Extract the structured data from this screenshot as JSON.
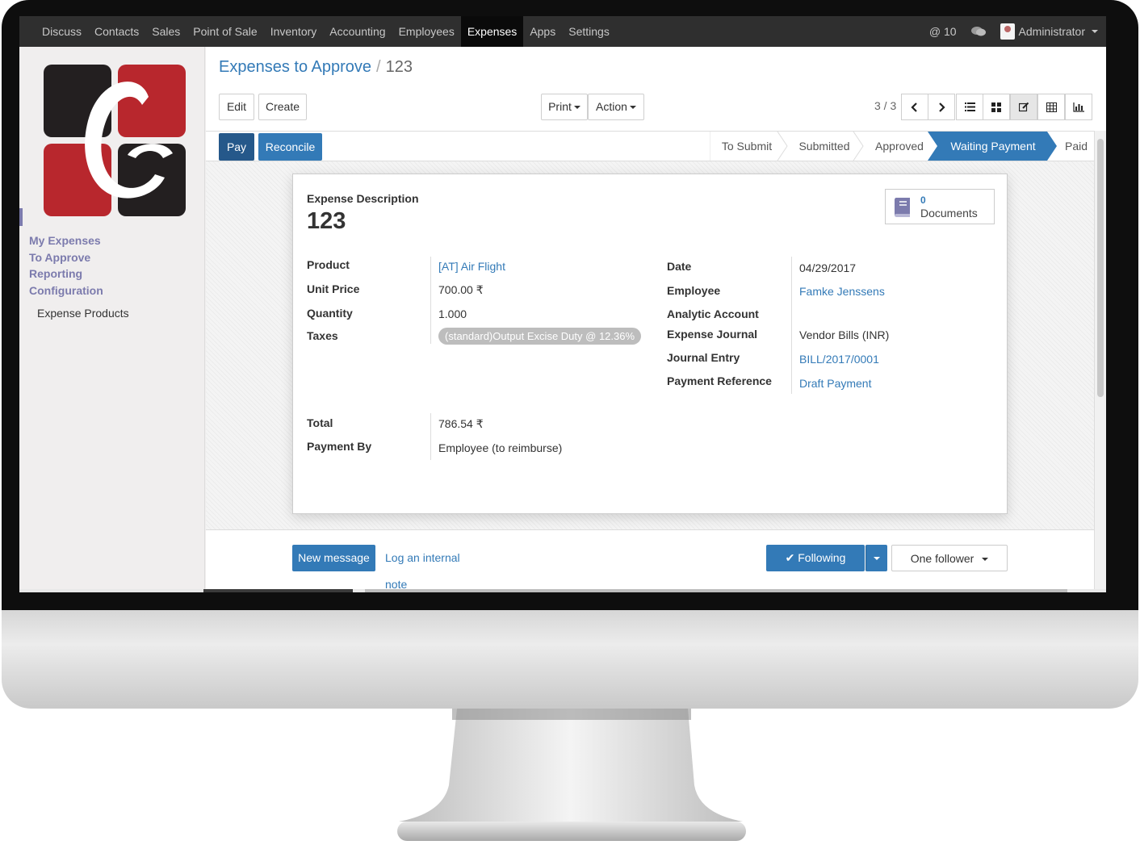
{
  "topnav": {
    "menu": [
      "Discuss",
      "Contacts",
      "Sales",
      "Point of Sale",
      "Inventory",
      "Accounting",
      "Employees",
      "Expenses",
      "Apps",
      "Settings"
    ],
    "active": "Expenses",
    "mentions": "@ 10",
    "user": "Administrator"
  },
  "sidebar": {
    "sections": [
      "My Expenses",
      "To Approve",
      "Reporting",
      "Configuration"
    ],
    "sub_item": "Expense Products"
  },
  "breadcrumb": {
    "parent": "Expenses to Approve",
    "separator": "/",
    "current": "123"
  },
  "buttons": {
    "edit": "Edit",
    "create": "Create",
    "print": "Print",
    "action": "Action"
  },
  "pager": "3 / 3",
  "status": {
    "pay": "Pay",
    "reconcile": "Reconcile",
    "stages": [
      "To Submit",
      "Submitted",
      "Approved",
      "Waiting Payment",
      "Paid"
    ],
    "active_stage": "Waiting Payment"
  },
  "form": {
    "description_label": "Expense Description",
    "description": "123",
    "documents_count": "0",
    "documents_label": "Documents",
    "left": {
      "product_label": "Product",
      "product": "[AT] Air Flight",
      "unit_price_label": "Unit Price",
      "unit_price": "700.00 ₹",
      "quantity_label": "Quantity",
      "quantity": "1.000",
      "taxes_label": "Taxes",
      "tax_tag": "(standard)Output Excise Duty @ 12.36%",
      "total_label": "Total",
      "total": "786.54 ₹",
      "payment_by_label": "Payment By",
      "payment_by": "Employee (to reimburse)"
    },
    "right": {
      "date_label": "Date",
      "date": "04/29/2017",
      "employee_label": "Employee",
      "employee": "Famke Jenssens",
      "analytic_label": "Analytic Account",
      "journal_label": "Expense Journal",
      "journal": "Vendor Bills (INR)",
      "entry_label": "Journal Entry",
      "entry": "BILL/2017/0001",
      "payref_label": "Payment Reference",
      "payref": "Draft Payment"
    }
  },
  "chatter": {
    "new_message": "New message",
    "log_note": "Log an internal note",
    "following": "Following",
    "followers": "One follower"
  },
  "colors": {
    "primary": "#337ab7",
    "navbar": "#2f2f2f",
    "sidebar_link": "#7c7bad"
  }
}
